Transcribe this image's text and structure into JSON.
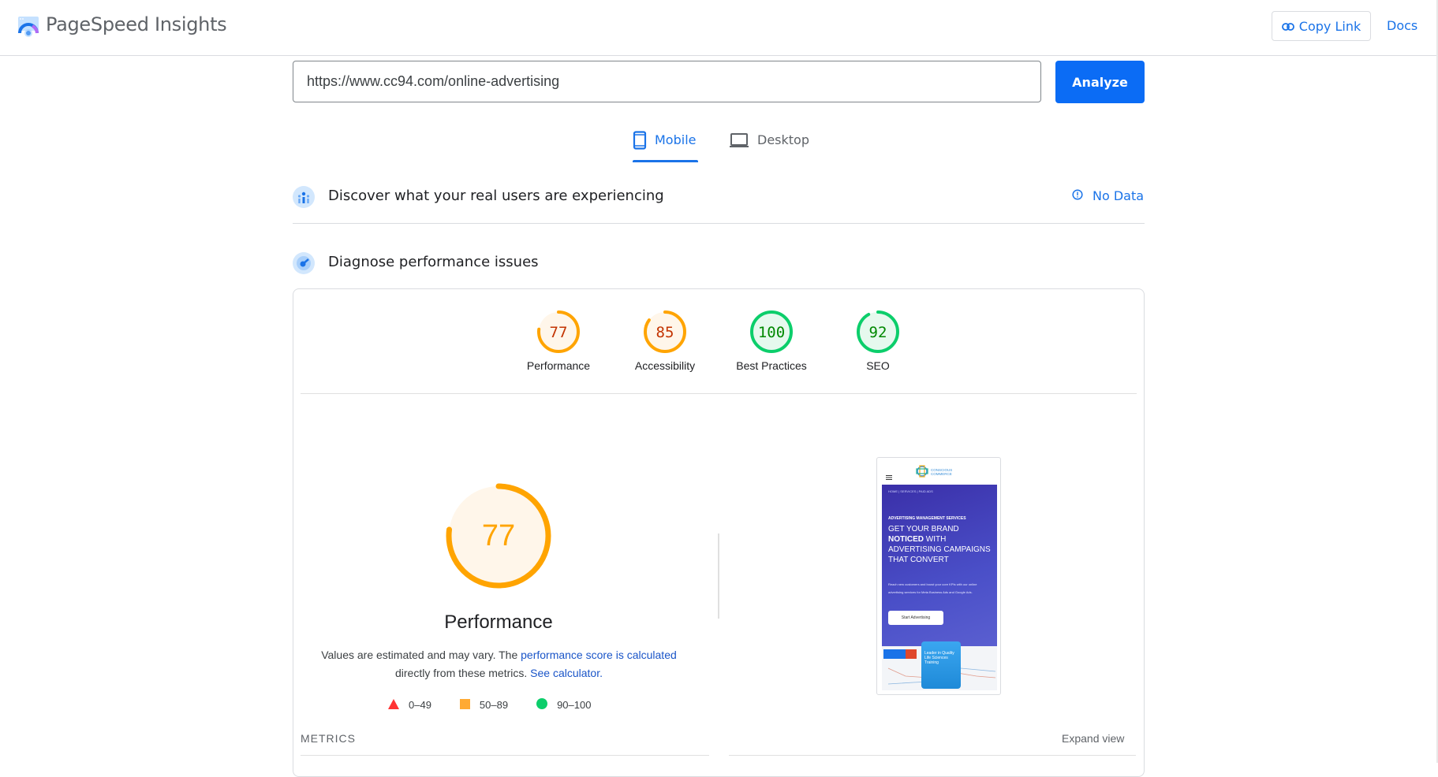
{
  "header": {
    "app_title": "PageSpeed Insights",
    "copy_link_label": "Copy Link",
    "docs_label": "Docs"
  },
  "url_bar": {
    "value": "https://www.cc94.com/online-advertising",
    "analyze_label": "Analyze"
  },
  "tabs": [
    {
      "label": "Mobile",
      "icon": "phone-icon",
      "active": true
    },
    {
      "label": "Desktop",
      "icon": "laptop-icon",
      "active": false
    }
  ],
  "field_data": {
    "title": "Discover what your real users are experiencing",
    "status_label": "No Data",
    "status_icon": "info-icon"
  },
  "lab_data": {
    "title": "Diagnose performance issues"
  },
  "scores": [
    {
      "label": "Performance",
      "value": 77,
      "rating": "average"
    },
    {
      "label": "Accessibility",
      "value": 85,
      "rating": "average"
    },
    {
      "label": "Best Practices",
      "value": 100,
      "rating": "pass"
    },
    {
      "label": "SEO",
      "value": 92,
      "rating": "pass"
    }
  ],
  "performance_detail": {
    "score": 77,
    "label": "Performance",
    "note_prefix": "Values are estimated and may vary. The ",
    "note_link1": "performance score is calculated",
    "note_middle": " directly from these metrics. ",
    "note_link2": "See calculator."
  },
  "legend": [
    {
      "range": "0–49",
      "shape": "triangle",
      "color": "#ff3333"
    },
    {
      "range": "50–89",
      "shape": "square",
      "color": "#ffaa33"
    },
    {
      "range": "90–100",
      "shape": "circle",
      "color": "#0cce6b"
    }
  ],
  "metrics_heading": "METRICS",
  "expand_view_label": "Expand view",
  "thumbnail": {
    "logo_text": "CONSCIOUS COMMERCE",
    "breadcrumb": "HOME  |  SERVICES  |  PAID ADS",
    "kicker": "ADVERTISING MANAGEMENT SERVICES",
    "headline_pre": "GET YOUR BRAND ",
    "headline_bold": "NOTICED",
    "headline_post": " WITH ADVERTISING CAMPAIGNS THAT CONVERT",
    "blurb": "Reach new customers and boost your core KPIs with our online advertising services for Meta Business Ads and Google Ads.",
    "cta": "Start Advertising",
    "card_text": "Leader in Quality Life Sciences Training"
  },
  "colors": {
    "accent": "#1a73e8",
    "analyze_bg": "#0b6cf5",
    "average": "#ffa400",
    "average_text": "#c33300",
    "average_bg": "#fff6ea",
    "pass": "#0cce6b",
    "pass_text": "#008800",
    "pass_bg": "#e6f9ee"
  }
}
